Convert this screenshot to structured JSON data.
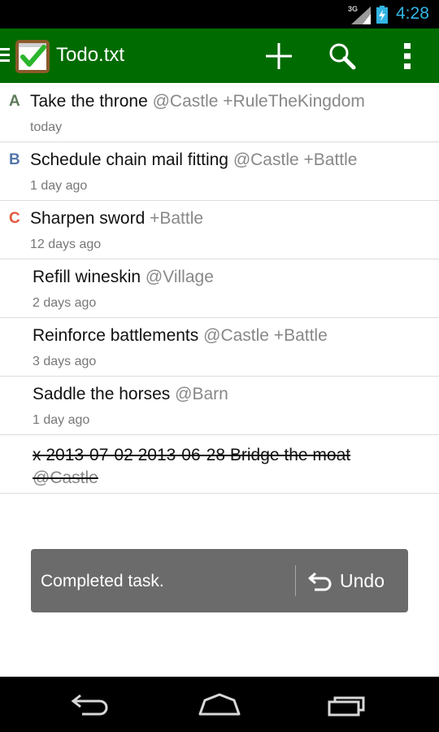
{
  "status_bar": {
    "network": "3G",
    "time": "4:28"
  },
  "action_bar": {
    "title": "Todo.txt",
    "actions": [
      "add-icon",
      "search-icon",
      "overflow-menu-icon"
    ]
  },
  "colors": {
    "action_bar": "#006b00",
    "priority_a": "#5d7a5a",
    "priority_b": "#5577a8",
    "priority_c": "#e0593e",
    "tag": "#888888",
    "clock": "#33b5e5"
  },
  "tasks": [
    {
      "priority": "A",
      "text": "Take the throne",
      "tags": "@Castle +RuleTheKingdom",
      "age": "today"
    },
    {
      "priority": "B",
      "text": "Schedule chain mail fitting",
      "tags": "@Castle +Battle",
      "age": "1 day ago"
    },
    {
      "priority": "C",
      "text": "Sharpen sword",
      "tags": "+Battle",
      "age": "12 days ago"
    },
    {
      "priority": "",
      "text": "Refill wineskin",
      "tags": "@Village",
      "age": "2 days ago"
    },
    {
      "priority": "",
      "text": "Reinforce battlements",
      "tags": "@Castle +Battle",
      "age": "3 days ago"
    },
    {
      "priority": "",
      "text": "Saddle the horses",
      "tags": "@Barn",
      "age": "1 day ago"
    }
  ],
  "completed_task": {
    "text": "x 2013-07-02 2013-06-28 Bridge the moat",
    "tags": "@Castle"
  },
  "toast": {
    "message": "Completed task.",
    "action_label": "Undo"
  },
  "nav_bar": [
    "back-icon",
    "home-icon",
    "recents-icon"
  ]
}
